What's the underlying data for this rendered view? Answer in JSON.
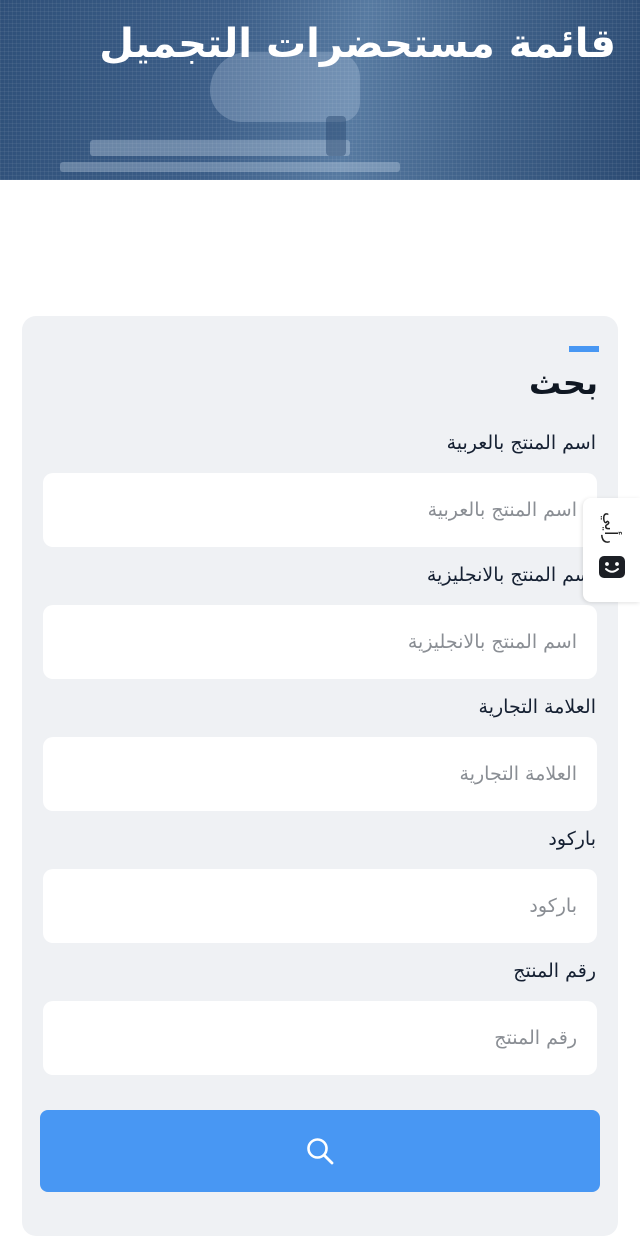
{
  "header": {
    "title": "قائمة مستحضرات التجميل"
  },
  "search_form": {
    "title": "بحث",
    "accent_color": "#4897f3",
    "fields": [
      {
        "label": "اسم المنتج بالعربية",
        "placeholder": "اسم المنتج بالعربية",
        "value": ""
      },
      {
        "label": "اسم المنتج بالانجليزية",
        "placeholder": "اسم المنتج بالانجليزية",
        "value": ""
      },
      {
        "label": "العلامة التجارية",
        "placeholder": "العلامة التجارية",
        "value": ""
      },
      {
        "label": "باركود",
        "placeholder": "باركود",
        "value": ""
      },
      {
        "label": "رقم المنتج",
        "placeholder": "رقم المنتج",
        "value": ""
      }
    ],
    "submit_icon": "search-icon"
  },
  "feedback_tab": {
    "label": "رأيي",
    "icon": "smiley-face-icon"
  }
}
